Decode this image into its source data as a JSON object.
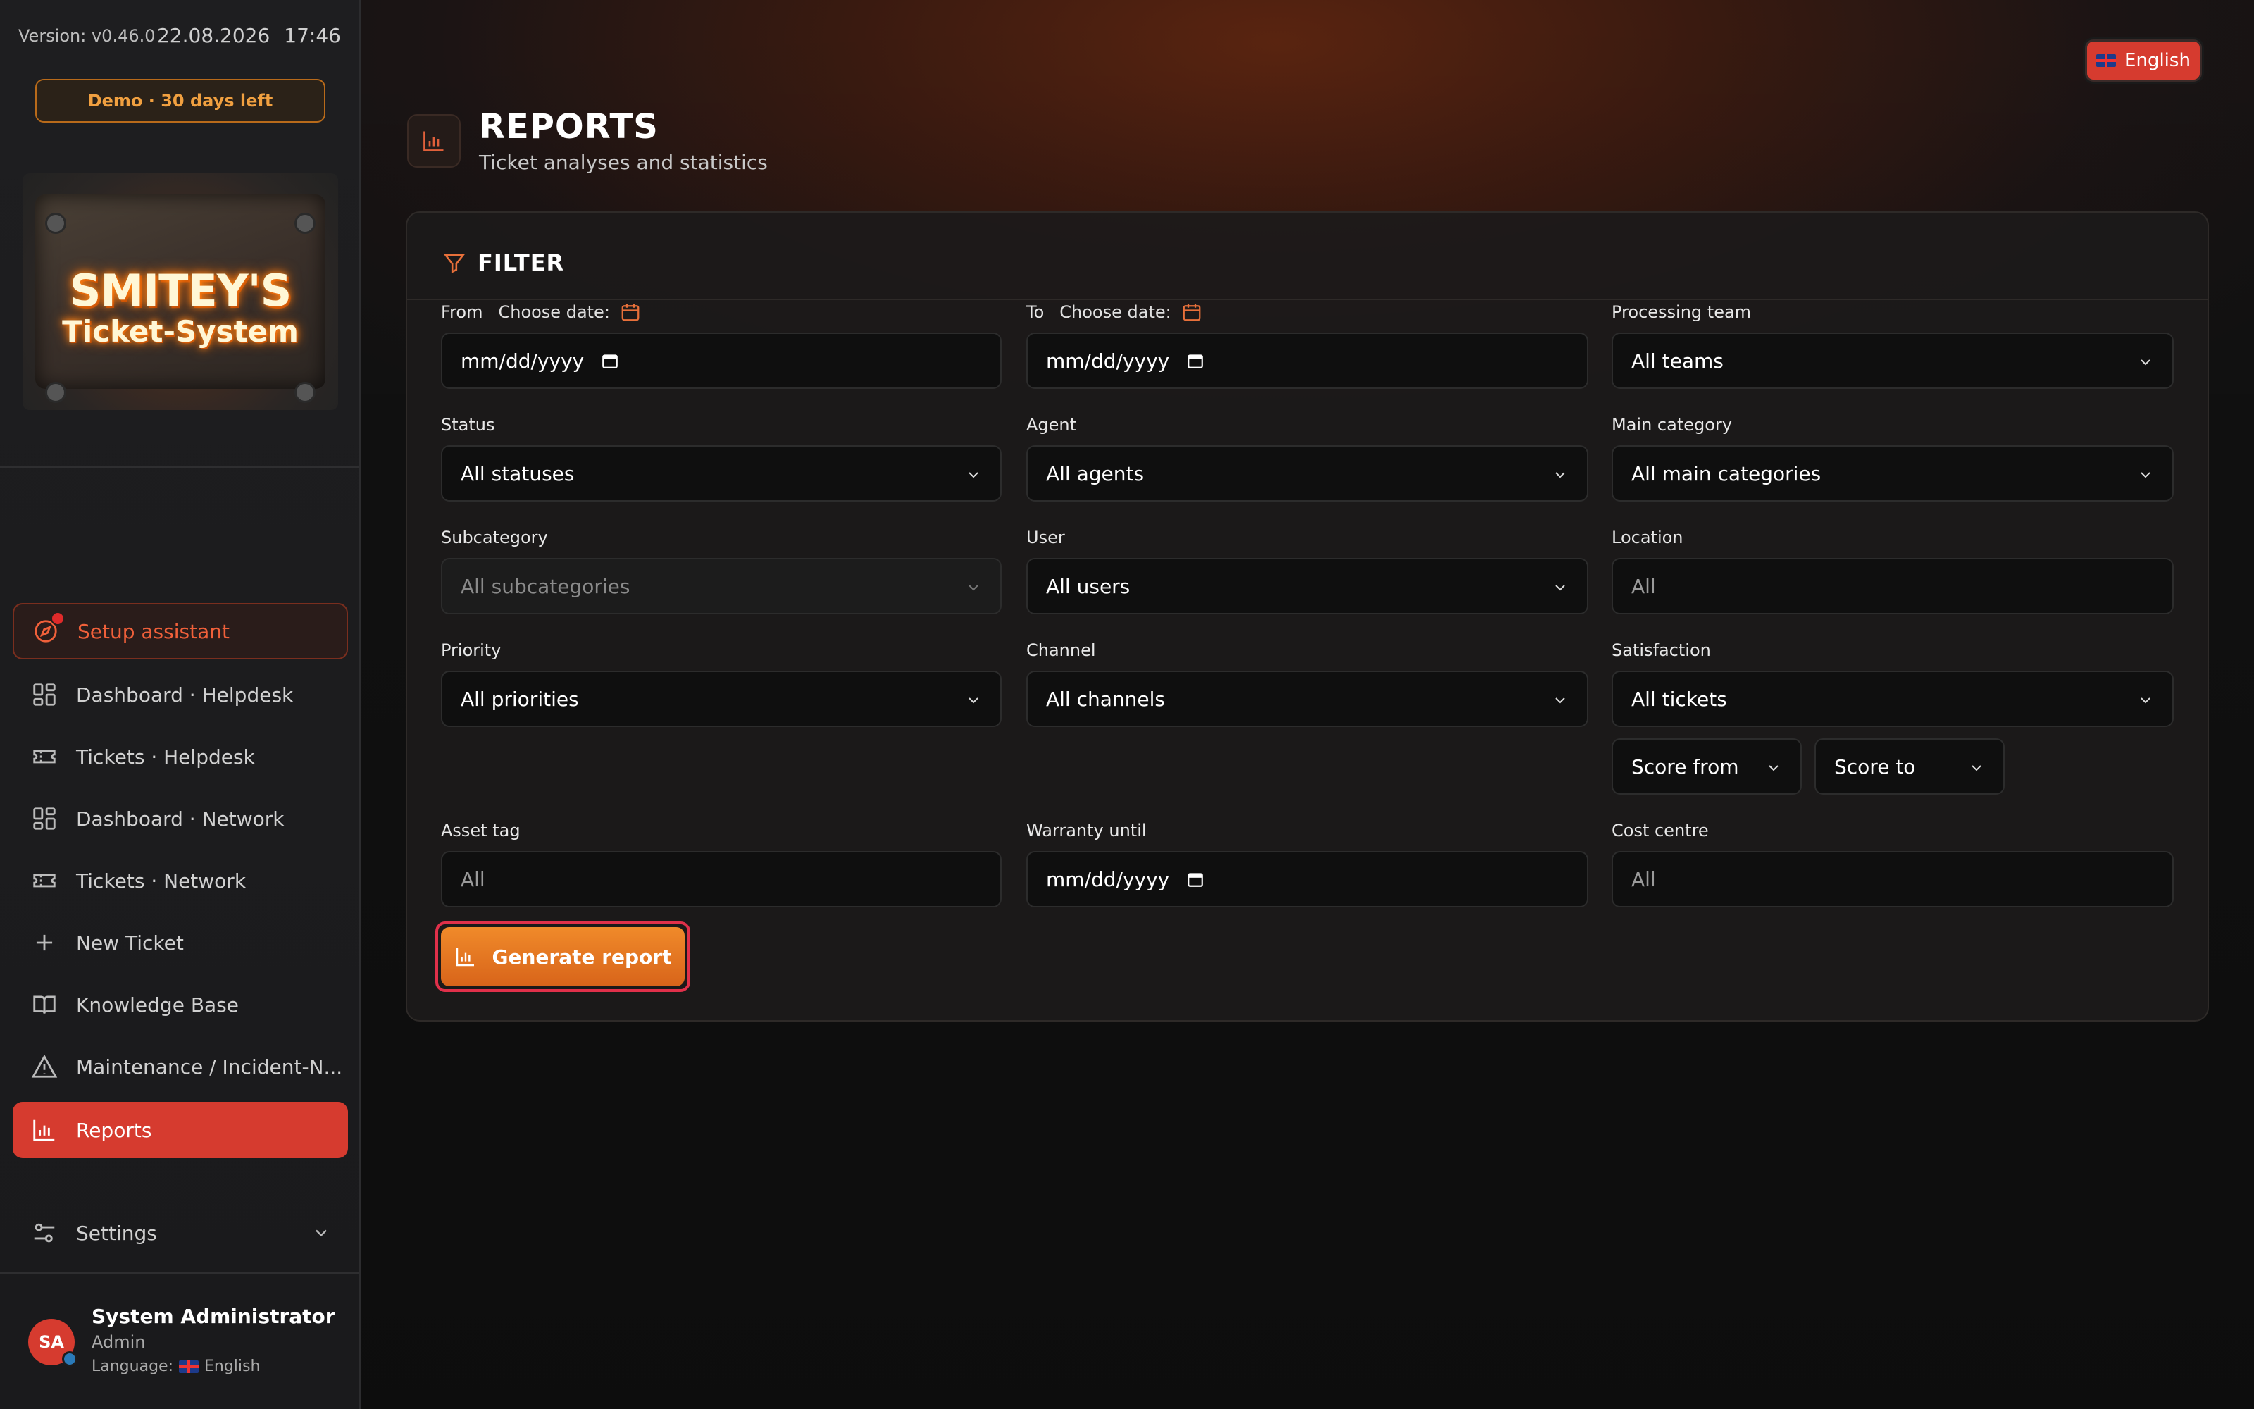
{
  "sidebar": {
    "version": "Version: v0.46.0",
    "date": "22.08.2026",
    "time": "17:46",
    "demo_badge": "Demo · 30 days left",
    "logo_line1": "SMITEY'S",
    "logo_line2": "Ticket-System",
    "nav": [
      {
        "label": "Setup assistant",
        "icon": "compass-icon"
      },
      {
        "label": "Dashboard · Helpdesk",
        "icon": "dashboard-icon"
      },
      {
        "label": "Tickets · Helpdesk",
        "icon": "ticket-icon"
      },
      {
        "label": "Dashboard · Network",
        "icon": "dashboard-icon"
      },
      {
        "label": "Tickets · Network",
        "icon": "ticket-icon"
      },
      {
        "label": "New Ticket",
        "icon": "plus-icon"
      },
      {
        "label": "Knowledge Base",
        "icon": "book-icon"
      },
      {
        "label": "Maintenance / Incident-N...",
        "icon": "warning-icon"
      },
      {
        "label": "Reports",
        "icon": "bar-chart-icon"
      },
      {
        "label": "Settings",
        "icon": "sliders-icon"
      }
    ],
    "user": {
      "initials": "SA",
      "name": "System Administrator",
      "role": "Admin",
      "language_label": "Language:",
      "language": "English"
    }
  },
  "header": {
    "language_button": "English",
    "title": "REPORTS",
    "subtitle": "Ticket analyses and statistics"
  },
  "filter": {
    "heading": "FILTER",
    "from_label": "From",
    "to_label": "To",
    "choose_date": "Choose date:",
    "date_placeholder": "mm/dd/yyyy",
    "processing_team_label": "Processing team",
    "processing_team_value": "All teams",
    "status_label": "Status",
    "status_value": "All statuses",
    "agent_label": "Agent",
    "agent_value": "All agents",
    "main_category_label": "Main category",
    "main_category_value": "All main categories",
    "subcategory_label": "Subcategory",
    "subcategory_value": "All subcategories",
    "user_label": "User",
    "user_value": "All users",
    "location_label": "Location",
    "location_placeholder": "All",
    "priority_label": "Priority",
    "priority_value": "All priorities",
    "channel_label": "Channel",
    "channel_value": "All channels",
    "satisfaction_label": "Satisfaction",
    "satisfaction_value": "All tickets",
    "score_from": "Score from",
    "score_to": "Score to",
    "asset_tag_label": "Asset tag",
    "asset_tag_placeholder": "All",
    "warranty_label": "Warranty until",
    "cost_centre_label": "Cost centre",
    "cost_centre_placeholder": "All",
    "generate_button": "Generate report"
  },
  "colors": {
    "accent": "#d63b2f",
    "orange": "#f08a2a",
    "background": "#111111"
  }
}
